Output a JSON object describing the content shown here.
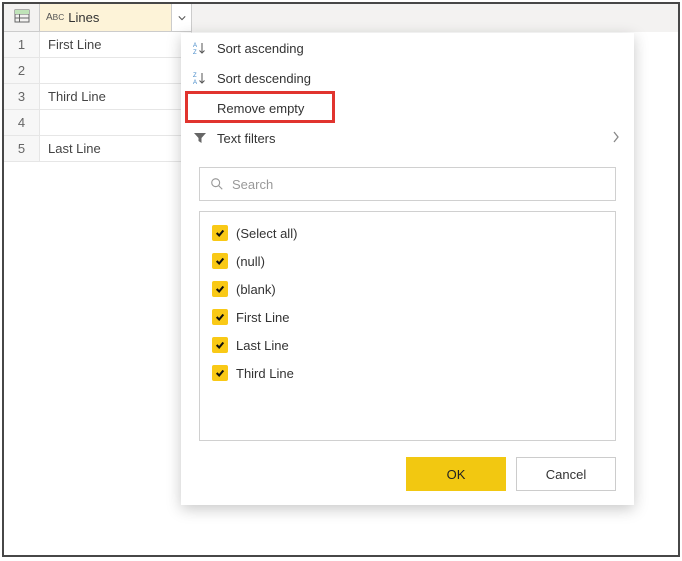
{
  "column": {
    "name": "Lines",
    "type_icon": "abc-type-icon"
  },
  "rows": [
    {
      "n": "1",
      "value": "First Line"
    },
    {
      "n": "2",
      "value": ""
    },
    {
      "n": "3",
      "value": "Third Line"
    },
    {
      "n": "4",
      "value": ""
    },
    {
      "n": "5",
      "value": "Last Line"
    }
  ],
  "menu": {
    "sort_asc": "Sort ascending",
    "sort_desc": "Sort descending",
    "remove_empty": "Remove empty",
    "text_filters": "Text filters"
  },
  "filter": {
    "search_placeholder": "Search",
    "values": [
      "(Select all)",
      "(null)",
      "(blank)",
      "First Line",
      "Last Line",
      "Third Line"
    ]
  },
  "buttons": {
    "ok": "OK",
    "cancel": "Cancel"
  }
}
